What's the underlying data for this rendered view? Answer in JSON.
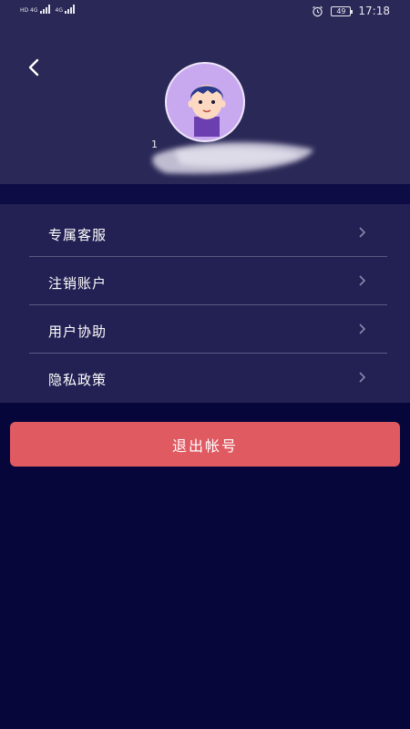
{
  "status_bar": {
    "sim1_tag": "HD 4G",
    "sim2_tag": "4G",
    "battery": "49",
    "time": "17:18"
  },
  "header": {
    "username_visible_prefix": "1"
  },
  "menu": {
    "items": [
      {
        "label": "专属客服"
      },
      {
        "label": "注销账户"
      },
      {
        "label": "用户协助"
      },
      {
        "label": "隐私政策"
      }
    ]
  },
  "logout": {
    "label": "退出帐号"
  },
  "colors": {
    "background": "#07063a",
    "header": "#2a2856",
    "menu": "#232153",
    "logout_button": "#e05a62"
  },
  "icons": {
    "back": "chevron-left-icon",
    "menu_arrow": "chevron-right-icon",
    "alarm": "alarm-icon",
    "battery": "battery-icon"
  }
}
